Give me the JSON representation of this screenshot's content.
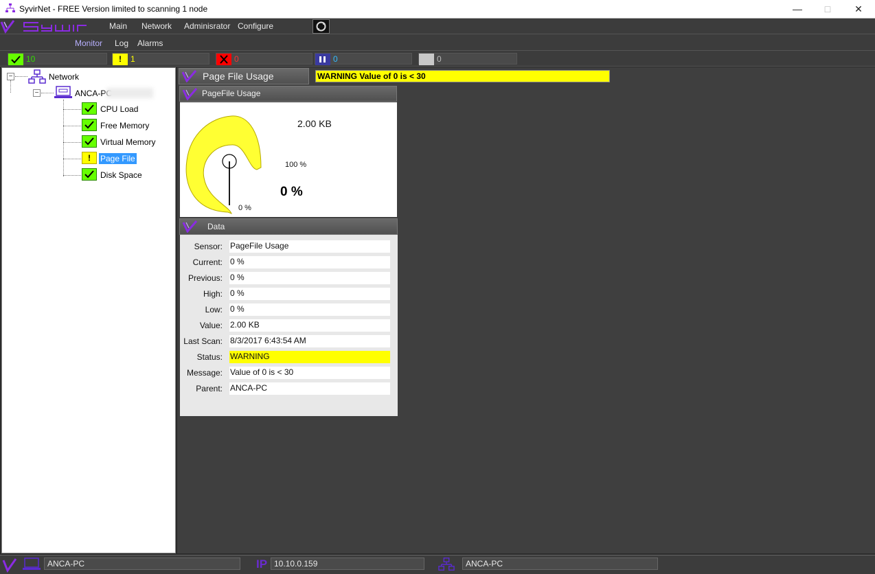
{
  "window": {
    "title": "SyvirNet - FREE Version limited to scanning 1 node"
  },
  "menu": {
    "items": [
      "Main",
      "Network",
      "Adminisrator",
      "Configure"
    ]
  },
  "submenu": {
    "items": [
      "Monitor",
      "Log",
      "Alarms"
    ]
  },
  "counters": [
    {
      "value": "10",
      "color": "#66ff00",
      "text_color": "#33dd00"
    },
    {
      "value": "1",
      "color": "#ffff00",
      "text_color": "#ffff00"
    },
    {
      "value": "0",
      "color": "#ff0000",
      "text_color": "#ff3030"
    },
    {
      "value": "0",
      "color": "#3a3aa0",
      "text_color": "#33bbff"
    },
    {
      "value": "0",
      "color": "#c8c8c8",
      "text_color": "#bbbbbb"
    }
  ],
  "tree": {
    "root": "Network",
    "host": "ANCA-PC",
    "items": [
      "CPU Load",
      "Free Memory",
      "Virtual Memory",
      "Page File",
      "Disk Space"
    ]
  },
  "header": {
    "title": "Page File Usage",
    "warning": "WARNING Value of 0 is < 30"
  },
  "gauge": {
    "panel_title": "PageFile Usage",
    "size": "2.00 KB",
    "max_label": "100 %",
    "min_label": "0 %",
    "current": "0 %",
    "fill_fraction": 0
  },
  "data": {
    "panel_title": "Data",
    "rows": [
      {
        "label": "Sensor:",
        "value": "PageFile Usage"
      },
      {
        "label": "Current:",
        "value": "0 %"
      },
      {
        "label": "Previous:",
        "value": "0 %"
      },
      {
        "label": "High:",
        "value": "0 %"
      },
      {
        "label": "Low:",
        "value": "0 %"
      },
      {
        "label": "Value:",
        "value": "2.00 KB"
      },
      {
        "label": "Last Scan:",
        "value": "8/3/2017 6:43:54 AM"
      },
      {
        "label": "Status:",
        "value": "WARNING"
      },
      {
        "label": "Message:",
        "value": "Value of 0 is < 30"
      },
      {
        "label": "Parent:",
        "value": "ANCA-PC"
      }
    ]
  },
  "footer": {
    "host": "ANCA-PC",
    "ip_label": "IP",
    "ip": "10.10.0.159",
    "network": "ANCA-PC"
  },
  "colors": {
    "brand": "#8a2be2",
    "warning": "#ffff00",
    "ok": "#66ff00"
  }
}
